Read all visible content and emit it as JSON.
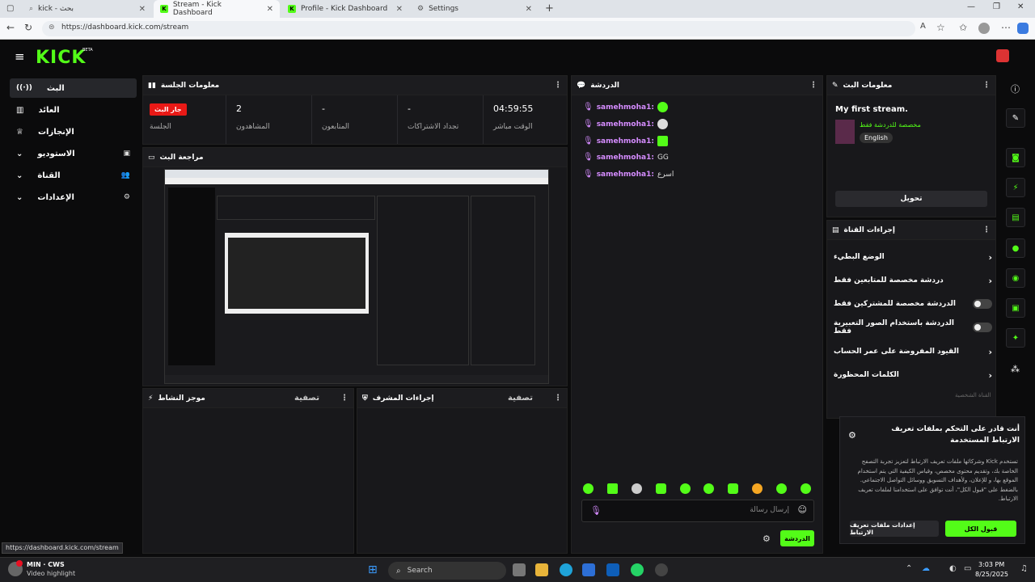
{
  "browser": {
    "tabs": [
      {
        "label": "kick - بحث",
        "active": false
      },
      {
        "label": "Stream - Kick Dashboard",
        "active": true
      },
      {
        "label": "Profile - Kick Dashboard",
        "active": false
      },
      {
        "label": "Settings",
        "active": false
      }
    ],
    "url": "https://dashboard.kick.com/stream",
    "status_url": "https://dashboard.kick.com/stream"
  },
  "site": {
    "logo": "KICK",
    "logo_badge": "BETA",
    "accent": "#53fc18",
    "sidebar": [
      {
        "label": "البث",
        "icon": "broadcast-icon",
        "active": true
      },
      {
        "label": "العائد",
        "icon": "chart-icon",
        "active": false
      },
      {
        "label": "الإنجازات",
        "icon": "trophy-icon",
        "active": false
      },
      {
        "label": "الاستوديو",
        "icon": "chevron-down-icon",
        "active": false
      },
      {
        "label": "القناة",
        "icon": "chevron-down-icon",
        "active": false
      },
      {
        "label": "الإعدادات",
        "icon": "chevron-down-icon",
        "active": false
      }
    ]
  },
  "session": {
    "title": "معلومات الجلسة",
    "live_badge": "جار البث",
    "session_label": "الجلسة",
    "viewers_value": "2",
    "viewers_label": "المشاهدون",
    "followers_value": "-",
    "followers_label": "المتابعون",
    "renewals_value": "-",
    "renewals_label": "تجداد الاشتراكات",
    "time_value": "04:59:55",
    "time_label": "الوقت مباشر"
  },
  "preview": {
    "title": "مراجعة البث"
  },
  "activity": {
    "title": "موجز النشاط",
    "filter": "تصفية"
  },
  "mod_actions": {
    "title": "إجراءات المشرف",
    "filter": "تصفية"
  },
  "chat": {
    "title": "الدردشة",
    "messages": [
      {
        "user": "samehmoha1:",
        "text": ""
      },
      {
        "user": "samehmoha1:",
        "text": ""
      },
      {
        "user": "samehmoha1:",
        "text": ""
      },
      {
        "user": "samehmoha1:",
        "text": "GG"
      },
      {
        "user": "samehmoha1:",
        "text": "اسرع"
      }
    ],
    "placeholder": "إرسال رسالة",
    "send_label": "الدردشة"
  },
  "stream_info": {
    "title": "معلومات البث",
    "stream_title": "My first stream.",
    "category": "مخصصة للدردشة فقط",
    "language": "English",
    "edit_label": "تحويل"
  },
  "channel_actions": {
    "title": "إجراءات القناة",
    "items": [
      {
        "label": "الوضع البطيء",
        "type": "chevron"
      },
      {
        "label": "دردشة مخصصة للمتابعين فقط",
        "type": "chevron"
      },
      {
        "label": "الدردشة مخصصة للمشتركين فقط",
        "type": "toggle"
      },
      {
        "label": "الدردشة باستخدام الصور التعبيرية فقط",
        "type": "toggle"
      },
      {
        "label": "القيود المفروضة على عمر الحساب",
        "type": "chevron"
      },
      {
        "label": "الكلمات المحظورة",
        "type": "chevron"
      }
    ],
    "section_label": "القناة الشخصية"
  },
  "cookie": {
    "title": "أنت قادر على التحكم بملفات تعريف الارتباط المستخدمة",
    "body": "تستخدم Kick وشركائها ملفات تعريف الارتباط لتعزيز تجربة التصفح الخاصة بك، وتقديم محتوى مخصص، وقياس الكيفية التي يتم استخدام الموقع بها، و للإعلان، ولأهداف التسويق ووسائل التواصل الاجتماعي. بالضغط على \"قبول الكل\"، أنت توافق على استخدامنا لملفات تعريف الارتباط.",
    "settings_btn": "إعدادات ملفات تعريف الارتباط",
    "accept_btn": "قبول الكل"
  },
  "taskbar": {
    "weather_title": "MIN · CWS",
    "weather_sub": "Video highlight",
    "search": "Search",
    "time": "3:03 PM",
    "date": "8/25/2025"
  }
}
